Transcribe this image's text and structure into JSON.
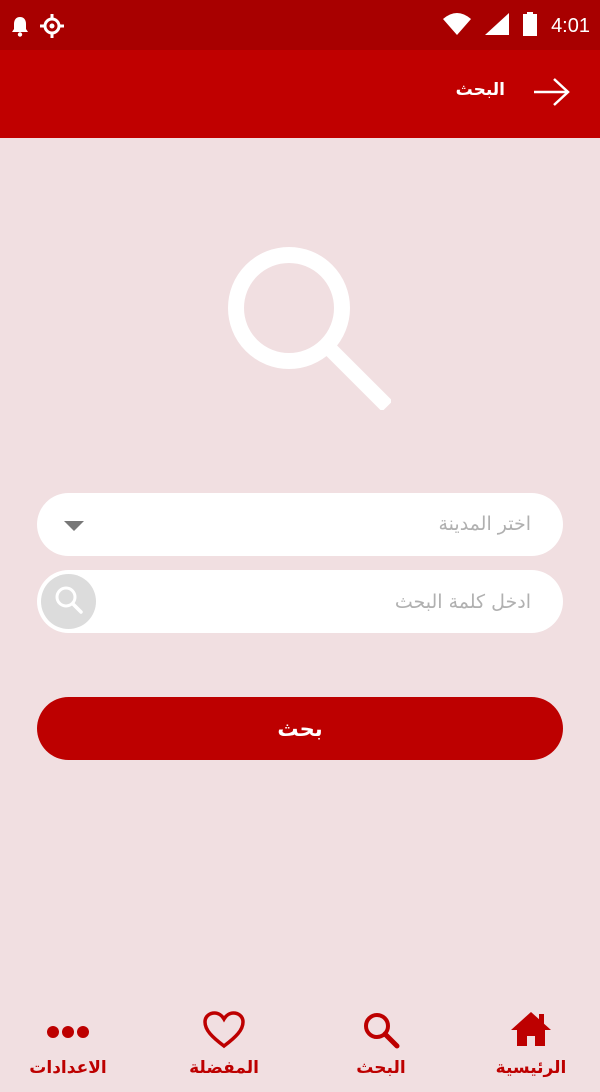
{
  "status_bar": {
    "time": "4:01",
    "icons": [
      "notification-bell-icon",
      "location-icon",
      "wifi-icon",
      "signal-icon",
      "battery-icon"
    ]
  },
  "app_bar": {
    "title": "البحث",
    "back_icon": "arrow-right-icon"
  },
  "form": {
    "city_placeholder": "اختر المدينة",
    "keyword_placeholder": "ادخل كلمة البحث",
    "submit_label": "بحث"
  },
  "bottom_nav": {
    "items": [
      {
        "label": "الرئيسية",
        "icon": "home-icon"
      },
      {
        "label": "البحث",
        "icon": "search-icon"
      },
      {
        "label": "المفضلة",
        "icon": "heart-icon"
      },
      {
        "label": "الاعدادات",
        "icon": "more-dots-icon"
      }
    ]
  },
  "colors": {
    "primary": "#c00000",
    "status_bar": "#a80000",
    "background": "#f1dfe1"
  }
}
